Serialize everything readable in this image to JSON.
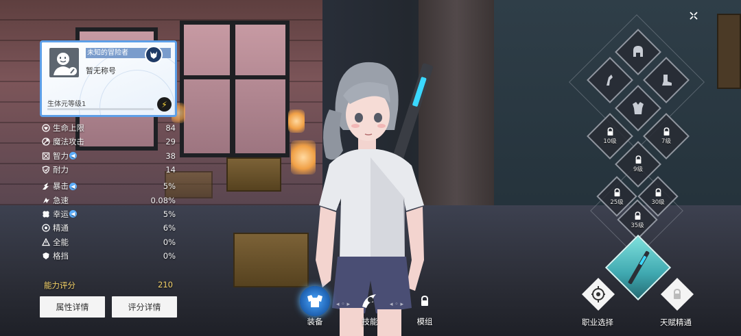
{
  "profile": {
    "name": "未知的冒险者",
    "title": "暂无称号",
    "level_label": "生体元等级1",
    "level_progress": 0.0
  },
  "stats": [
    {
      "icon": "heart-icon",
      "label": "生命上限",
      "info": false,
      "value": "84"
    },
    {
      "icon": "magic-attack-icon",
      "label": "魔法攻击",
      "info": false,
      "value": "29"
    },
    {
      "icon": "intellect-icon",
      "label": "智力",
      "info": true,
      "value": "38"
    },
    {
      "icon": "shield-icon",
      "label": "耐力",
      "info": false,
      "value": "14"
    },
    {
      "icon": "crit-icon",
      "label": "暴击",
      "info": true,
      "value": "5%"
    },
    {
      "icon": "haste-icon",
      "label": "急速",
      "info": false,
      "value": "0.08%"
    },
    {
      "icon": "luck-icon",
      "label": "幸运",
      "info": true,
      "value": "5%"
    },
    {
      "icon": "mastery-icon",
      "label": "精通",
      "info": false,
      "value": "6%"
    },
    {
      "icon": "versatility-icon",
      "label": "全能",
      "info": false,
      "value": "0%"
    },
    {
      "icon": "block-icon",
      "label": "格挡",
      "info": false,
      "value": "0%"
    }
  ],
  "score": {
    "label": "能力评分",
    "value": "210"
  },
  "buttons": {
    "attr_details": "属性详情",
    "score_details": "评分详情"
  },
  "tabs": {
    "equip": "装备",
    "skill": "技能",
    "module": "模组"
  },
  "slots": {
    "level_10": "10级",
    "level_7": "7级",
    "level_9": "9级",
    "level_25": "25级",
    "level_30": "30级",
    "level_35": "35级"
  },
  "bottom": {
    "class_select": "职业选择",
    "talent": "天赋精通"
  },
  "colors": {
    "card_border": "#5d9fe8",
    "score_gold": "#f5d36a",
    "weapon_teal": "#3fa8b0"
  }
}
